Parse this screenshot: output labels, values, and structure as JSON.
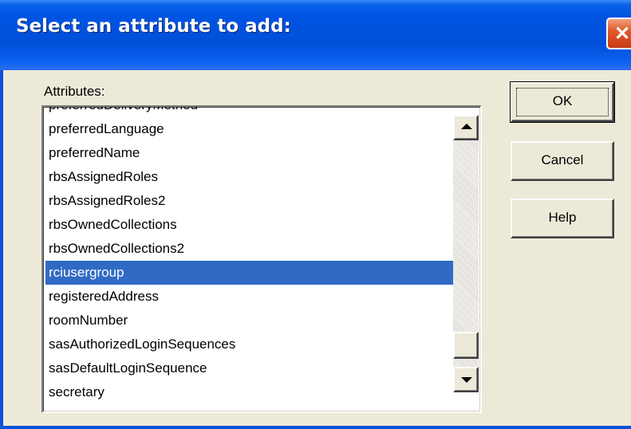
{
  "dialog": {
    "title": "Select an attribute to add:",
    "close_icon": "close-icon"
  },
  "attributes_label": "Attributes:",
  "attributes": [
    "preferredDeliveryMethod",
    "preferredLanguage",
    "preferredName",
    "rbsAssignedRoles",
    "rbsAssignedRoles2",
    "rbsOwnedCollections",
    "rbsOwnedCollections2",
    "rciusergroup",
    "registeredAddress",
    "roomNumber",
    "sasAuthorizedLoginSequences",
    "sasDefaultLoginSequence",
    "secretary"
  ],
  "selected_attribute": "rciusergroup",
  "buttons": {
    "ok": "OK",
    "cancel": "Cancel",
    "help": "Help"
  },
  "colors": {
    "selection": "#316ac5",
    "title_bar": "#0054e3",
    "dialog_bg": "#ece9d8"
  }
}
